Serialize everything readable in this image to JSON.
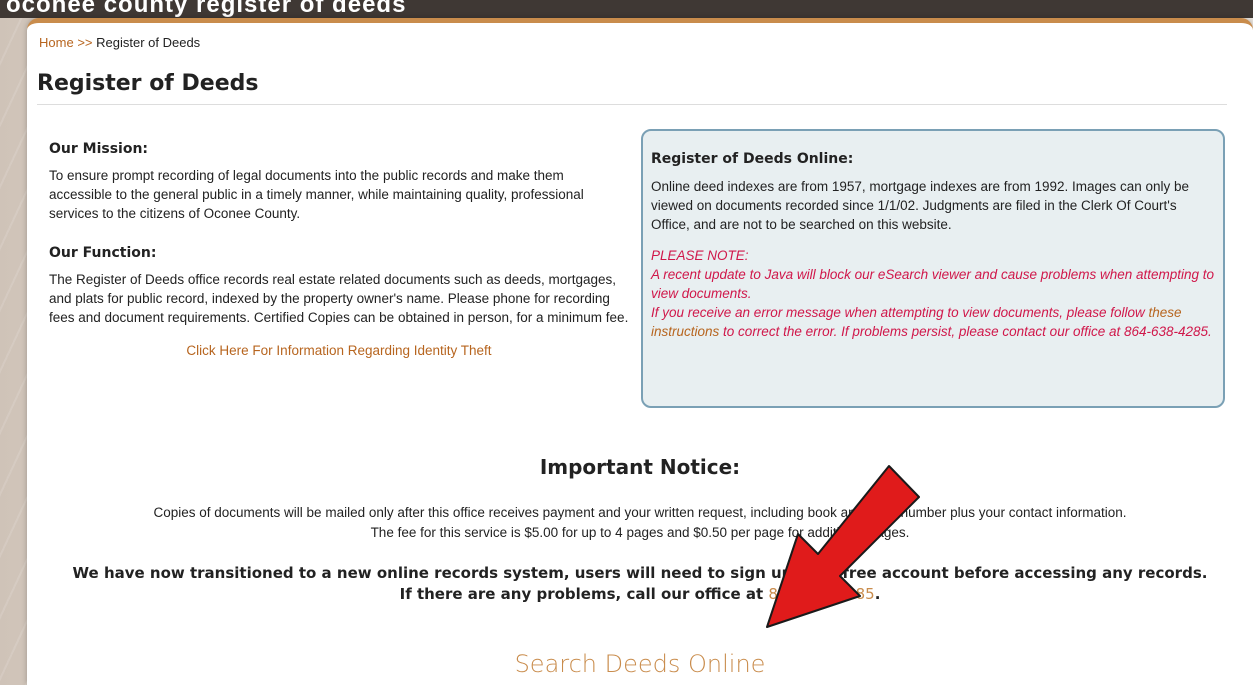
{
  "header_strip": {
    "text": "oconee county register of deeds"
  },
  "breadcrumb": {
    "home": "Home",
    "separator": ">>",
    "current": "Register of Deeds"
  },
  "page": {
    "title": "Register of Deeds"
  },
  "mission": {
    "heading": "Our Mission:",
    "text": "To ensure prompt recording of legal documents into the public records and make them accessible to the general public in a timely manner, while maintaining quality, professional services to the citizens of Oconee County."
  },
  "function": {
    "heading": "Our Function:",
    "text": "The Register of Deeds office records real estate related documents such as deeds, mortgages, and plats for public record, indexed by the property owner's name. Please phone for recording fees and document requirements. Certified Copies can be obtained in person, for a minimum fee."
  },
  "identity_theft_link": "Click Here For Information Regarding Identity Theft",
  "online_box": {
    "heading": "Register of Deeds Online:",
    "text": "Online deed indexes are from 1957, mortgage indexes are from 1992. Images can only be viewed on documents recorded since 1/1/02. Judgments are filed in the Clerk Of Court's Office, and are not to be searched on this website.",
    "note_label": "PLEASE NOTE:",
    "note_line1": "A recent update to Java will block our eSearch viewer and cause problems when attempting to view documents.",
    "note_line2_start": "If you receive an error message when attempting to view documents, please follow",
    "note_link": "these instructions",
    "note_line2_end": "to correct the error. If problems persist, please contact our office at 864-638-4285."
  },
  "notice": {
    "title": "Important Notice:",
    "line1": "Copies of documents will be mailed only after this office receives payment and your written request, including book and page number plus your contact information.",
    "line2": "The fee for this service is $5.00 for up to 4 pages and $0.50 per page for additional pages.",
    "transition": "We have now transitioned to a new online records system, users will need to sign up for a free account before accessing any records. If there are any problems, call our office at",
    "phone": "864-638-4285",
    "end": "."
  },
  "search_link": "Search Deeds Online",
  "colors": {
    "accent": "#c98c4c",
    "link": "#b7651f",
    "note": "#d0174a",
    "box_border": "#7aa0b5",
    "arrow": "#e01b1b"
  }
}
